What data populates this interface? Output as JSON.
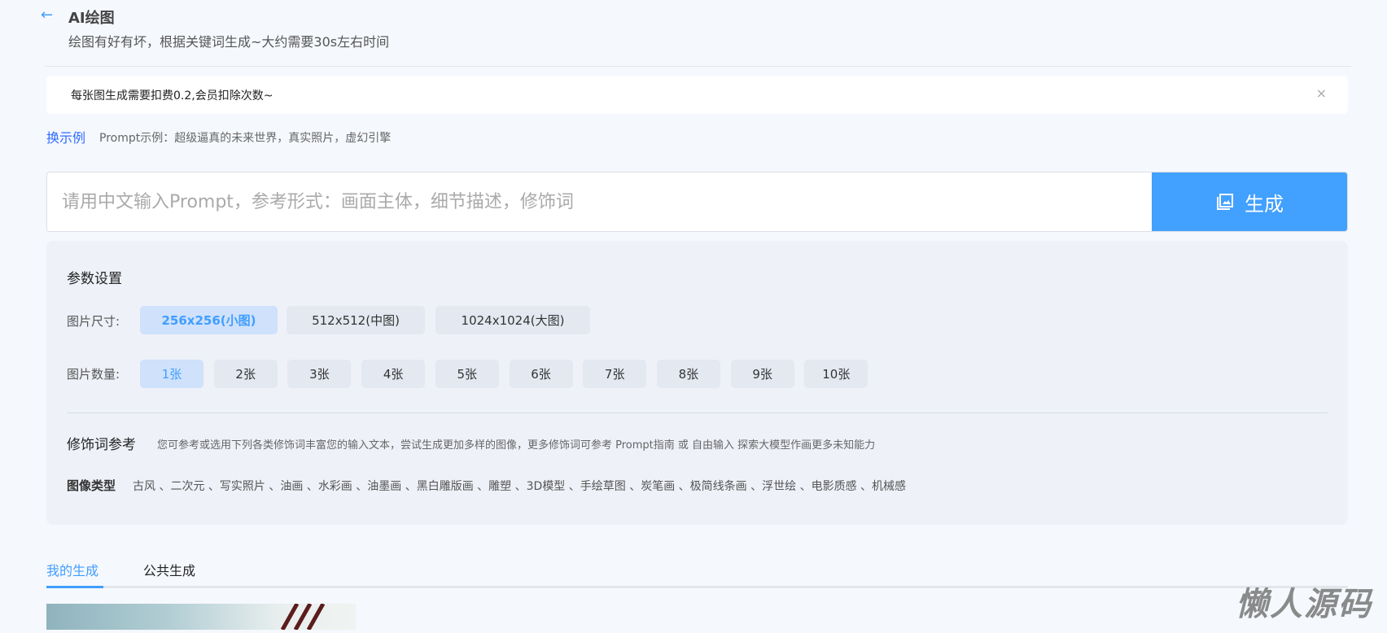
{
  "header": {
    "title": "AI绘图",
    "subtitle": "绘图有好有坏，根据关键词生成~大约需要30s左右时间"
  },
  "notice": {
    "text": "每张图生成需要扣费0.2,会员扣除次数~",
    "close": "×"
  },
  "example": {
    "swap_label": "换示例",
    "text": "Prompt示例：超级逼真的未来世界，真实照片，虚幻引擎"
  },
  "prompt": {
    "placeholder": "请用中文输入Prompt，参考形式：画面主体，细节描述，修饰词",
    "value": "",
    "generate_label": "生成"
  },
  "params": {
    "title": "参数设置",
    "size_label": "图片尺寸:",
    "sizes": [
      "256x256(小图)",
      "512x512(中图)",
      "1024x1024(大图)"
    ],
    "size_selected": 0,
    "count_label": "图片数量:",
    "counts": [
      "1张",
      "2张",
      "3张",
      "4张",
      "5张",
      "6张",
      "7张",
      "8张",
      "9张",
      "10张"
    ],
    "count_selected": 0,
    "modifier_title": "修饰词参考",
    "modifier_desc": "您可参考或选用下列各类修饰词丰富您的输入文本，尝试生成更加多样的图像，更多修饰词可参考 Prompt指南 或 自由输入 探索大模型作画更多未知能力",
    "type_title": "图像类型",
    "types": [
      "古风",
      "二次元",
      "写实照片",
      "油画",
      "水彩画",
      "油墨画",
      "黑白雕版画",
      "雕塑",
      "3D模型",
      "手绘草图",
      "炭笔画",
      "极简线条画",
      "浮世绘",
      "电影质感",
      "机械感"
    ]
  },
  "tabs": [
    {
      "label": "我的生成",
      "active": true
    },
    {
      "label": "公共生成",
      "active": false
    }
  ],
  "watermark": "懒人源码",
  "colors": {
    "accent": "#409eff",
    "button": "#42a0ff",
    "link": "#2f6bff"
  }
}
